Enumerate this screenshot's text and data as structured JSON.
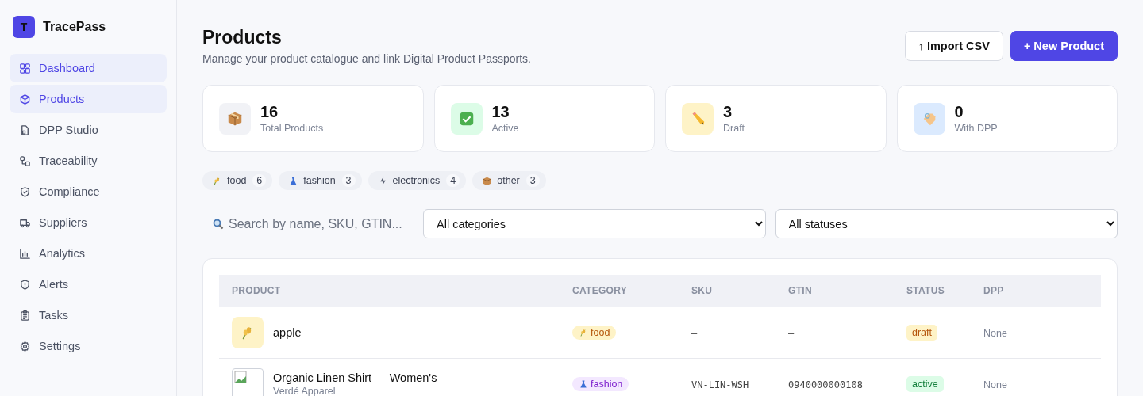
{
  "brand": {
    "initial": "T",
    "name": "TracePass"
  },
  "sidebar": {
    "items": [
      {
        "label": "Dashboard",
        "kind": "grid",
        "selected": true
      },
      {
        "label": "Products",
        "kind": "cube",
        "selected": true
      },
      {
        "label": "DPP Studio",
        "kind": "doc",
        "selected": false
      },
      {
        "label": "Traceability",
        "kind": "nodes",
        "selected": false
      },
      {
        "label": "Compliance",
        "kind": "shield",
        "selected": false
      },
      {
        "label": "Suppliers",
        "kind": "truck",
        "selected": false
      },
      {
        "label": "Analytics",
        "kind": "bars",
        "selected": false
      },
      {
        "label": "Alerts",
        "kind": "alert",
        "selected": false
      },
      {
        "label": "Tasks",
        "kind": "clipboard",
        "selected": false
      },
      {
        "label": "Settings",
        "kind": "gear",
        "selected": false
      }
    ]
  },
  "header": {
    "title": "Products",
    "subtitle": "Manage your product catalogue and link Digital Product Passports.",
    "buttons": [
      {
        "label": "↑ Import CSV",
        "kind": "secondary"
      },
      {
        "label": "+ New Product",
        "kind": "primary"
      }
    ]
  },
  "stats": [
    {
      "value": "16",
      "label": "Total Products",
      "kind": "box"
    },
    {
      "value": "13",
      "label": "Active",
      "kind": "check"
    },
    {
      "value": "3",
      "label": "Draft",
      "kind": "pencil"
    },
    {
      "value": "0",
      "label": "With DPP",
      "kind": "tag"
    }
  ],
  "category_chips": [
    {
      "label": "food",
      "count": "6",
      "kind": "food"
    },
    {
      "label": "fashion",
      "count": "3",
      "kind": "fashion"
    },
    {
      "label": "electronics",
      "count": "4",
      "kind": "electronics"
    },
    {
      "label": "other",
      "count": "3",
      "kind": "other"
    }
  ],
  "filters": {
    "search_placeholder": "Search by name, SKU, GTIN...",
    "category": "All categories",
    "status": "All statuses"
  },
  "table": {
    "columns": [
      "PRODUCT",
      "CATEGORY",
      "SKU",
      "GTIN",
      "STATUS",
      "DPP"
    ],
    "rows": [
      {
        "name": "apple",
        "thumb": {
          "kind": "food"
        },
        "category": {
          "label": "food",
          "kind": "food"
        },
        "sku": "—",
        "gtin": "—",
        "status": "draft",
        "dpp": "None"
      },
      {
        "name": "Organic Linen Shirt — Women's",
        "brand": "Verdé Apparel",
        "thumb": {
          "kind": "broken"
        },
        "category": {
          "label": "fashion",
          "kind": "fashion"
        },
        "sku": "VN-LIN-WSH",
        "gtin": "0940000000108",
        "status": "active",
        "dpp": "None"
      }
    ]
  }
}
